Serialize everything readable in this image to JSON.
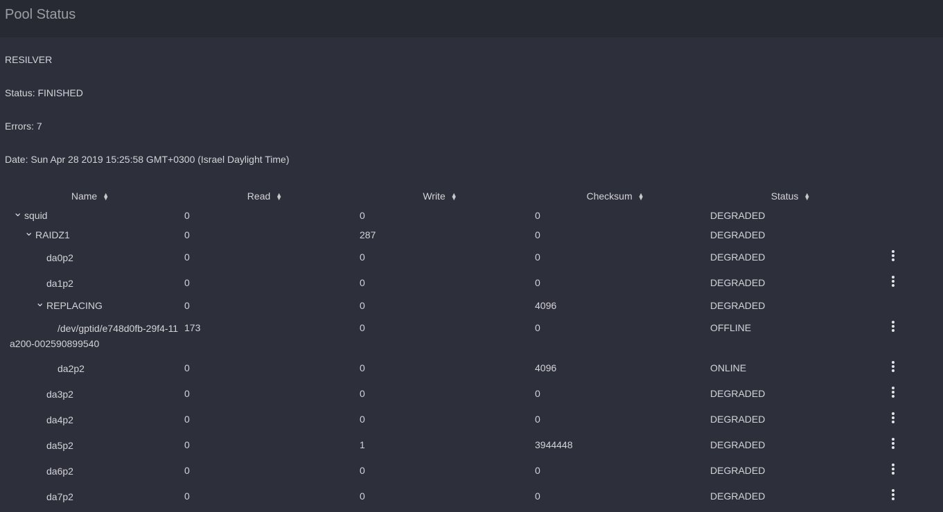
{
  "header": {
    "title": "Pool Status"
  },
  "scan": {
    "type": "RESILVER",
    "status": "Status: FINISHED",
    "errors": "Errors: 7",
    "date": "Date: Sun Apr 28 2019 15:25:58 GMT+0300 (Israel Daylight Time)"
  },
  "table": {
    "columns": [
      "Name",
      "Read",
      "Write",
      "Checksum",
      "Status"
    ],
    "sort_icon": "sort-updown-icon",
    "rows": [
      {
        "name": "squid",
        "level": 0,
        "expandable": true,
        "read": "0",
        "write": "0",
        "checksum": "0",
        "status": "DEGRADED",
        "menu": false
      },
      {
        "name": "RAIDZ1",
        "level": 1,
        "expandable": true,
        "read": "0",
        "write": "287",
        "checksum": "0",
        "status": "DEGRADED",
        "menu": false
      },
      {
        "name": "da0p2",
        "level": 2,
        "expandable": false,
        "read": "0",
        "write": "0",
        "checksum": "0",
        "status": "DEGRADED",
        "menu": true
      },
      {
        "name": "da1p2",
        "level": 2,
        "expandable": false,
        "read": "0",
        "write": "0",
        "checksum": "0",
        "status": "DEGRADED",
        "menu": true
      },
      {
        "name": "REPLACING",
        "level": 2,
        "expandable": true,
        "read": "0",
        "write": "0",
        "checksum": "4096",
        "status": "DEGRADED",
        "menu": false
      },
      {
        "name": "/dev/gptid/e748d0fb-29f4-11a200-002590899540",
        "level": 3,
        "expandable": false,
        "read": "173",
        "write": "0",
        "checksum": "0",
        "status": "OFFLINE",
        "menu": true
      },
      {
        "name": "da2p2",
        "level": 3,
        "expandable": false,
        "read": "0",
        "write": "0",
        "checksum": "4096",
        "status": "ONLINE",
        "menu": true
      },
      {
        "name": "da3p2",
        "level": 2,
        "expandable": false,
        "read": "0",
        "write": "0",
        "checksum": "0",
        "status": "DEGRADED",
        "menu": true
      },
      {
        "name": "da4p2",
        "level": 2,
        "expandable": false,
        "read": "0",
        "write": "0",
        "checksum": "0",
        "status": "DEGRADED",
        "menu": true
      },
      {
        "name": "da5p2",
        "level": 2,
        "expandable": false,
        "read": "0",
        "write": "1",
        "checksum": "3944448",
        "status": "DEGRADED",
        "menu": true
      },
      {
        "name": "da6p2",
        "level": 2,
        "expandable": false,
        "read": "0",
        "write": "0",
        "checksum": "0",
        "status": "DEGRADED",
        "menu": true
      },
      {
        "name": "da7p2",
        "level": 2,
        "expandable": false,
        "read": "0",
        "write": "0",
        "checksum": "0",
        "status": "DEGRADED",
        "menu": true
      }
    ]
  }
}
